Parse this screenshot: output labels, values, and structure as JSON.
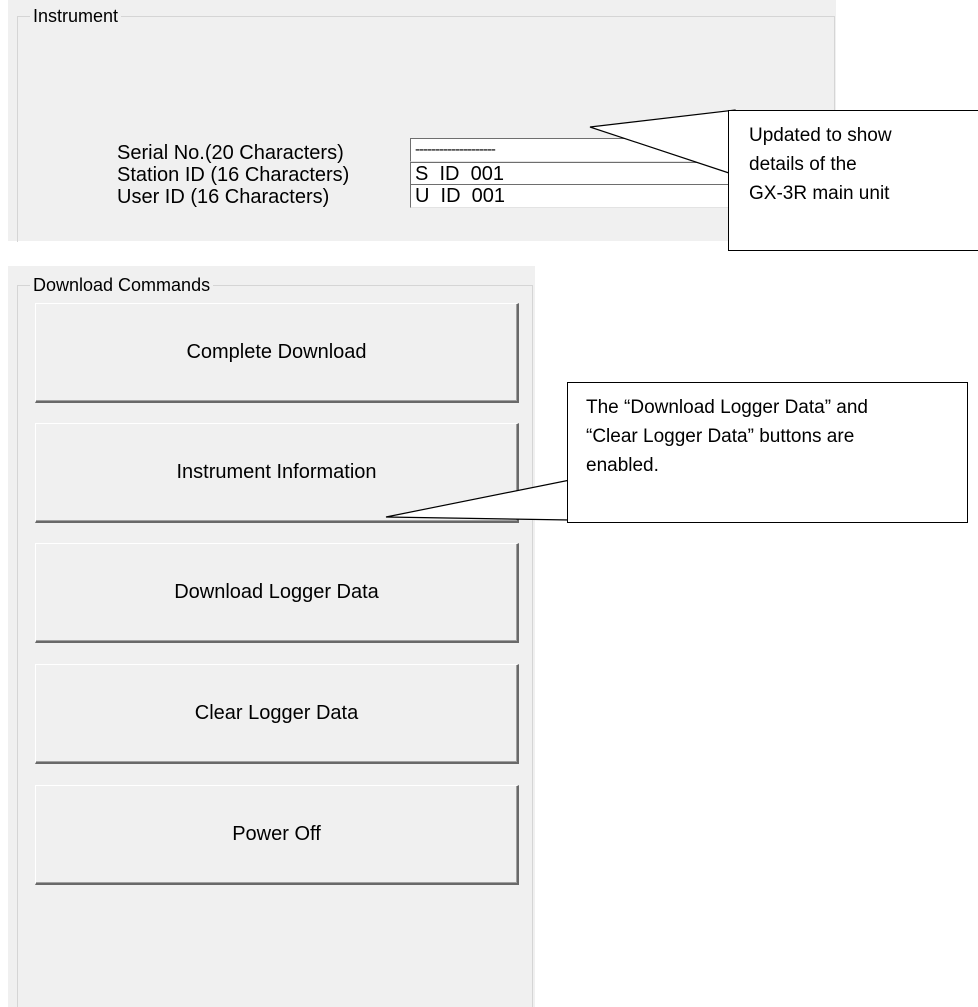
{
  "instrument": {
    "group_title": "Instrument",
    "serial": {
      "label": "Serial No.(20 Characters)",
      "value": "--------------------"
    },
    "station": {
      "label": "Station ID (16 Characters)",
      "value": "S  ID  001"
    },
    "user": {
      "label": "User ID (16 Characters)",
      "value": "U  ID  001"
    }
  },
  "download_commands": {
    "group_title": "Download Commands",
    "buttons": [
      "Complete Download",
      "Instrument Information",
      "Download Logger Data",
      "Clear Logger Data",
      "Power Off"
    ]
  },
  "callouts": {
    "instrument_note": [
      "Updated to show",
      "details of the",
      "GX-3R main unit"
    ],
    "buttons_note": [
      "The “Download Logger Data” and",
      "“Clear Logger Data” buttons are",
      "enabled."
    ]
  }
}
